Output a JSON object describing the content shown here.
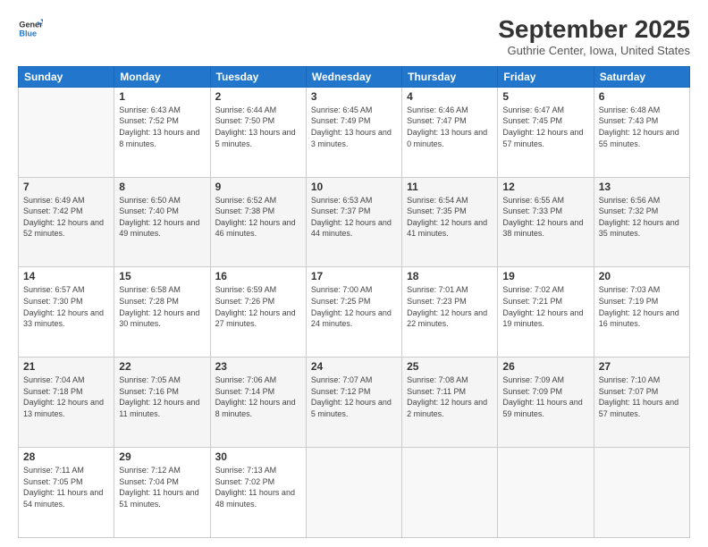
{
  "logo": {
    "line1": "General",
    "line2": "Blue"
  },
  "title": "September 2025",
  "location": "Guthrie Center, Iowa, United States",
  "days_of_week": [
    "Sunday",
    "Monday",
    "Tuesday",
    "Wednesday",
    "Thursday",
    "Friday",
    "Saturday"
  ],
  "weeks": [
    [
      {
        "day": "",
        "empty": true
      },
      {
        "day": "1",
        "sunrise": "Sunrise: 6:43 AM",
        "sunset": "Sunset: 7:52 PM",
        "daylight": "Daylight: 13 hours and 8 minutes."
      },
      {
        "day": "2",
        "sunrise": "Sunrise: 6:44 AM",
        "sunset": "Sunset: 7:50 PM",
        "daylight": "Daylight: 13 hours and 5 minutes."
      },
      {
        "day": "3",
        "sunrise": "Sunrise: 6:45 AM",
        "sunset": "Sunset: 7:49 PM",
        "daylight": "Daylight: 13 hours and 3 minutes."
      },
      {
        "day": "4",
        "sunrise": "Sunrise: 6:46 AM",
        "sunset": "Sunset: 7:47 PM",
        "daylight": "Daylight: 13 hours and 0 minutes."
      },
      {
        "day": "5",
        "sunrise": "Sunrise: 6:47 AM",
        "sunset": "Sunset: 7:45 PM",
        "daylight": "Daylight: 12 hours and 57 minutes."
      },
      {
        "day": "6",
        "sunrise": "Sunrise: 6:48 AM",
        "sunset": "Sunset: 7:43 PM",
        "daylight": "Daylight: 12 hours and 55 minutes."
      }
    ],
    [
      {
        "day": "7",
        "sunrise": "Sunrise: 6:49 AM",
        "sunset": "Sunset: 7:42 PM",
        "daylight": "Daylight: 12 hours and 52 minutes."
      },
      {
        "day": "8",
        "sunrise": "Sunrise: 6:50 AM",
        "sunset": "Sunset: 7:40 PM",
        "daylight": "Daylight: 12 hours and 49 minutes."
      },
      {
        "day": "9",
        "sunrise": "Sunrise: 6:52 AM",
        "sunset": "Sunset: 7:38 PM",
        "daylight": "Daylight: 12 hours and 46 minutes."
      },
      {
        "day": "10",
        "sunrise": "Sunrise: 6:53 AM",
        "sunset": "Sunset: 7:37 PM",
        "daylight": "Daylight: 12 hours and 44 minutes."
      },
      {
        "day": "11",
        "sunrise": "Sunrise: 6:54 AM",
        "sunset": "Sunset: 7:35 PM",
        "daylight": "Daylight: 12 hours and 41 minutes."
      },
      {
        "day": "12",
        "sunrise": "Sunrise: 6:55 AM",
        "sunset": "Sunset: 7:33 PM",
        "daylight": "Daylight: 12 hours and 38 minutes."
      },
      {
        "day": "13",
        "sunrise": "Sunrise: 6:56 AM",
        "sunset": "Sunset: 7:32 PM",
        "daylight": "Daylight: 12 hours and 35 minutes."
      }
    ],
    [
      {
        "day": "14",
        "sunrise": "Sunrise: 6:57 AM",
        "sunset": "Sunset: 7:30 PM",
        "daylight": "Daylight: 12 hours and 33 minutes."
      },
      {
        "day": "15",
        "sunrise": "Sunrise: 6:58 AM",
        "sunset": "Sunset: 7:28 PM",
        "daylight": "Daylight: 12 hours and 30 minutes."
      },
      {
        "day": "16",
        "sunrise": "Sunrise: 6:59 AM",
        "sunset": "Sunset: 7:26 PM",
        "daylight": "Daylight: 12 hours and 27 minutes."
      },
      {
        "day": "17",
        "sunrise": "Sunrise: 7:00 AM",
        "sunset": "Sunset: 7:25 PM",
        "daylight": "Daylight: 12 hours and 24 minutes."
      },
      {
        "day": "18",
        "sunrise": "Sunrise: 7:01 AM",
        "sunset": "Sunset: 7:23 PM",
        "daylight": "Daylight: 12 hours and 22 minutes."
      },
      {
        "day": "19",
        "sunrise": "Sunrise: 7:02 AM",
        "sunset": "Sunset: 7:21 PM",
        "daylight": "Daylight: 12 hours and 19 minutes."
      },
      {
        "day": "20",
        "sunrise": "Sunrise: 7:03 AM",
        "sunset": "Sunset: 7:19 PM",
        "daylight": "Daylight: 12 hours and 16 minutes."
      }
    ],
    [
      {
        "day": "21",
        "sunrise": "Sunrise: 7:04 AM",
        "sunset": "Sunset: 7:18 PM",
        "daylight": "Daylight: 12 hours and 13 minutes."
      },
      {
        "day": "22",
        "sunrise": "Sunrise: 7:05 AM",
        "sunset": "Sunset: 7:16 PM",
        "daylight": "Daylight: 12 hours and 11 minutes."
      },
      {
        "day": "23",
        "sunrise": "Sunrise: 7:06 AM",
        "sunset": "Sunset: 7:14 PM",
        "daylight": "Daylight: 12 hours and 8 minutes."
      },
      {
        "day": "24",
        "sunrise": "Sunrise: 7:07 AM",
        "sunset": "Sunset: 7:12 PM",
        "daylight": "Daylight: 12 hours and 5 minutes."
      },
      {
        "day": "25",
        "sunrise": "Sunrise: 7:08 AM",
        "sunset": "Sunset: 7:11 PM",
        "daylight": "Daylight: 12 hours and 2 minutes."
      },
      {
        "day": "26",
        "sunrise": "Sunrise: 7:09 AM",
        "sunset": "Sunset: 7:09 PM",
        "daylight": "Daylight: 11 hours and 59 minutes."
      },
      {
        "day": "27",
        "sunrise": "Sunrise: 7:10 AM",
        "sunset": "Sunset: 7:07 PM",
        "daylight": "Daylight: 11 hours and 57 minutes."
      }
    ],
    [
      {
        "day": "28",
        "sunrise": "Sunrise: 7:11 AM",
        "sunset": "Sunset: 7:05 PM",
        "daylight": "Daylight: 11 hours and 54 minutes."
      },
      {
        "day": "29",
        "sunrise": "Sunrise: 7:12 AM",
        "sunset": "Sunset: 7:04 PM",
        "daylight": "Daylight: 11 hours and 51 minutes."
      },
      {
        "day": "30",
        "sunrise": "Sunrise: 7:13 AM",
        "sunset": "Sunset: 7:02 PM",
        "daylight": "Daylight: 11 hours and 48 minutes."
      },
      {
        "day": "",
        "empty": true
      },
      {
        "day": "",
        "empty": true
      },
      {
        "day": "",
        "empty": true
      },
      {
        "day": "",
        "empty": true
      }
    ]
  ]
}
